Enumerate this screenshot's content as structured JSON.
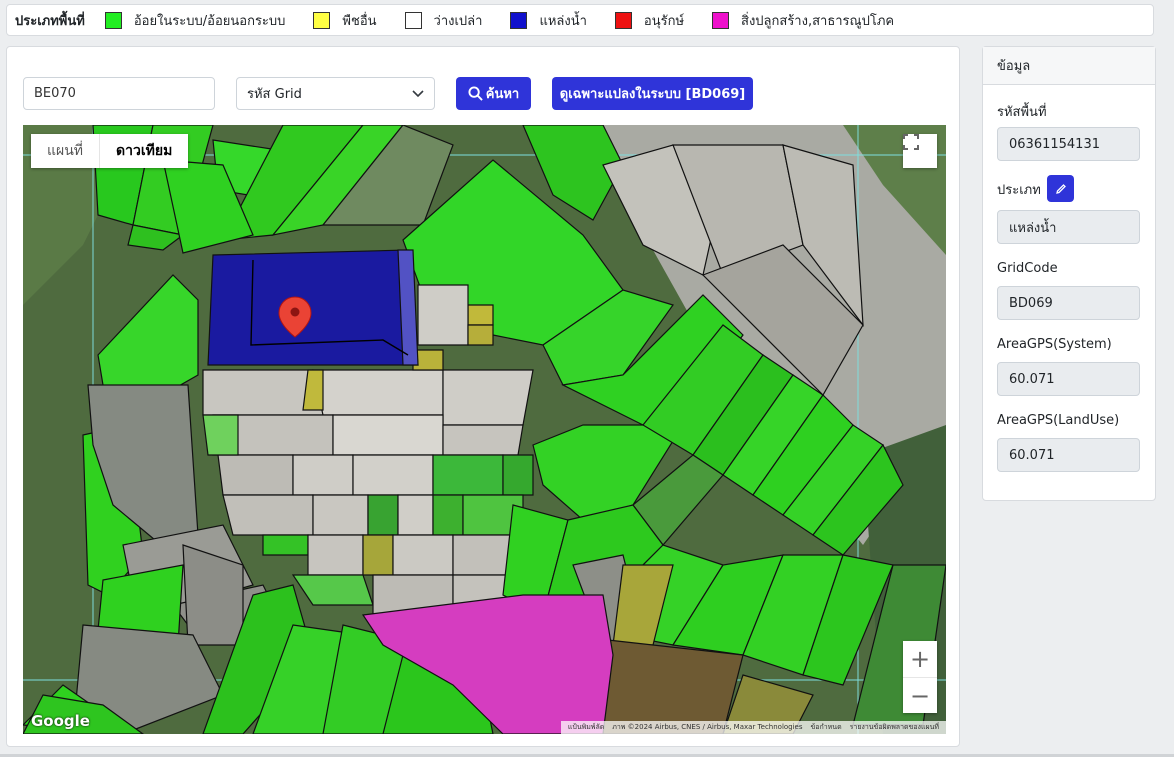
{
  "legend": {
    "title": "ประเภทพื้นที่",
    "items": [
      {
        "label": "อ้อยในระบบ/อ้อยนอกระบบ",
        "color": "#22ee22"
      },
      {
        "label": "พืชอื่น",
        "color": "#ffff44"
      },
      {
        "label": "ว่างเปล่า",
        "color": "#ffffff"
      },
      {
        "label": "แหล่งน้ำ",
        "color": "#1111cc"
      },
      {
        "label": "อนุรักษ์",
        "color": "#ee1111"
      },
      {
        "label": "สิ่งปลูกสร้าง,สาธารณูปโภค",
        "color": "#ee11cc"
      }
    ]
  },
  "search": {
    "value": "BE070",
    "select_value": "รหัส Grid",
    "search_button": "ค้นหา",
    "filter_button": "ดูเฉพาะแปลงในระบบ [BD069]"
  },
  "map": {
    "map_type_road": "แผนที่",
    "map_type_satellite": "ดาวเทียม",
    "logo": "Google",
    "attribution": {
      "shortcuts": "แป้นพิมพ์ลัด",
      "imagery": "ภาพ ©2024 Airbus, CNES / Airbus, Maxar Technologies",
      "terms": "ข้อกำหนด",
      "report": "รายงานข้อผิดพลาดของแผนที่"
    },
    "zoom_in": "+",
    "zoom_out": "−"
  },
  "info": {
    "title": "ข้อมูล",
    "code_label": "รหัสพื้นที่",
    "code_value": "06361154131",
    "type_label": "ประเภท",
    "type_value": "แหล่งน้ำ",
    "grid_label": "GridCode",
    "grid_value": "BD069",
    "area_system_label": "AreaGPS(System)",
    "area_system_value": "60.071",
    "area_landuse_label": "AreaGPS(LandUse)",
    "area_landuse_value": "60.071"
  },
  "colors": {
    "accent": "#2f34d9",
    "sugarcane": "#22dd22",
    "water": "#1a1aa0",
    "building": "#dd33bb"
  }
}
